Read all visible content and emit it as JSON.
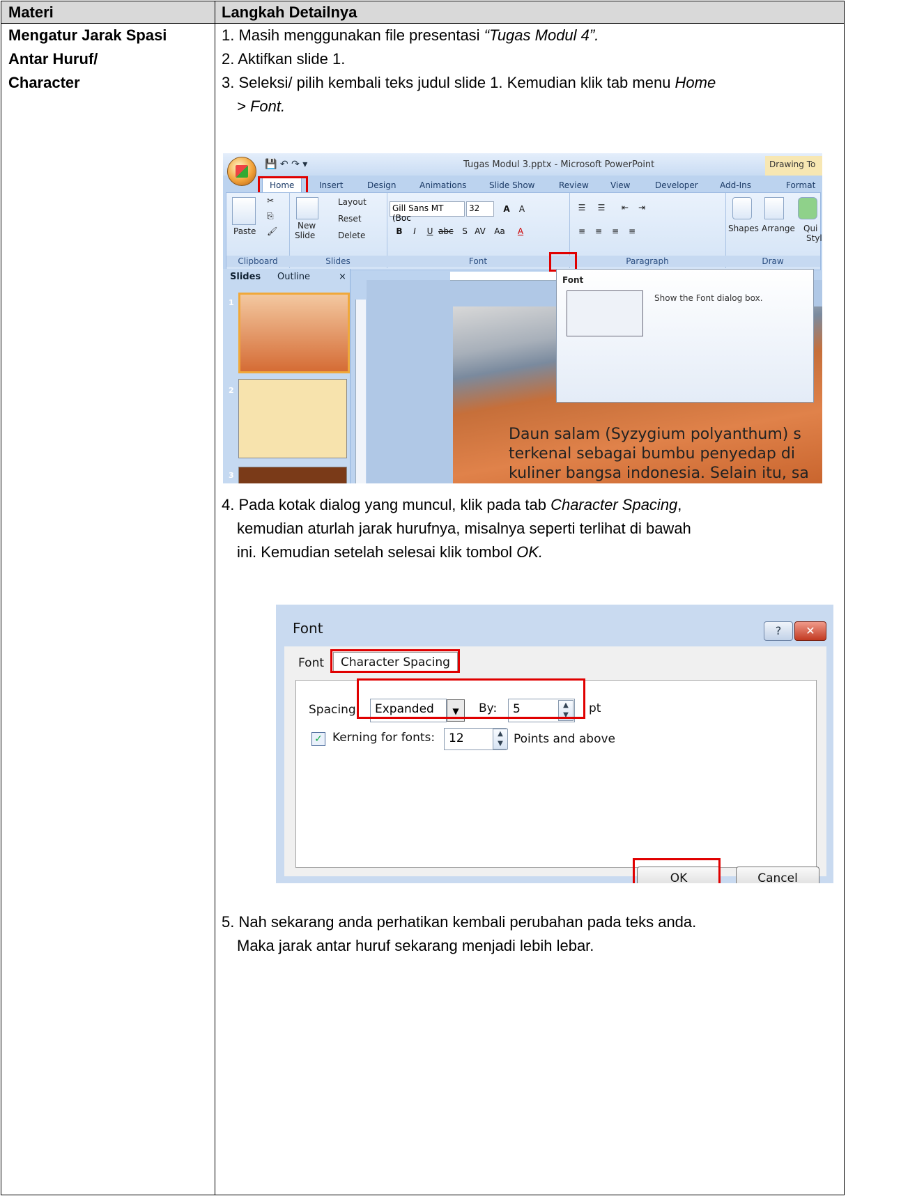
{
  "table": {
    "header": {
      "col1": "Materi",
      "col2": "Langkah Detailnya"
    },
    "materi_lines": [
      "Mengatur Jarak Spasi",
      "Antar Huruf/",
      "Character"
    ],
    "step1": {
      "num": "1.",
      "text": " Masih menggunakan file presentasi ",
      "italic": "“Tugas Modul 4”."
    },
    "step2": "2. Aktifkan slide 1.",
    "step3": {
      "text": "3. Seleksi/ pilih kembali teks judul slide 1. Kemudian klik tab menu ",
      "italic1": "Home",
      "line2_italic": "> Font."
    },
    "step4": {
      "l1a": "4. Pada kotak dialog yang muncul, klik pada tab ",
      "l1i": "Character Spacing",
      "l1b": ",",
      "l2": "kemudian aturlah jarak hurufnya, misalnya seperti terlihat di bawah",
      "l3a": "ini. Kemudian setelah selesai klik tombol ",
      "l3i": "OK."
    },
    "step5": {
      "l1": "5. Nah sekarang anda perhatikan kembali perubahan pada teks anda.",
      "l2": "Maka jarak antar huruf sekarang menjadi lebih lebar."
    }
  },
  "ppt": {
    "window_title": "Tugas Modul 3.pptx - Microsoft PowerPoint",
    "context_tab": "Drawing To",
    "tabs": [
      "Home",
      "Insert",
      "Design",
      "Animations",
      "Slide Show",
      "Review",
      "View",
      "Developer",
      "Add-Ins",
      "Format"
    ],
    "groups": {
      "clipboard": "Clipboard",
      "slides": "Slides",
      "font": "Font",
      "paragraph": "Paragraph",
      "drawing": "Draw"
    },
    "clipboard": {
      "paste": "Paste"
    },
    "slides_group": {
      "new": "New",
      "slide": "Slide",
      "layout": "Layout",
      "reset": "Reset",
      "delete": "Delete"
    },
    "font_name": "Gill Sans MT (Boc",
    "font_size": "32",
    "drawing_labels": {
      "shapes": "Shapes",
      "arrange": "Arrange",
      "quick": "Qui",
      "style": "Styl"
    },
    "pane_tabs": {
      "slides": "Slides",
      "outline": "Outline"
    },
    "thumbs": [
      "1",
      "2",
      "3"
    ],
    "tooltip": {
      "title": "Font",
      "desc": "Show the Font dialog box."
    },
    "slide_text": [
      "Daun salam (Syzygium polyanthum) s",
      "terkenal sebagai bumbu penyedap di",
      "kuliner bangsa indonesia. Selain itu, sa"
    ]
  },
  "dialog": {
    "title": "Font",
    "help": "?",
    "close": "✕",
    "tab_font": "Font",
    "tab_spacing": "Character Spacing",
    "spacing_label": "Spacing:",
    "spacing_value": "Expanded",
    "by_label": "By:",
    "by_value": "5",
    "pt_label": "pt",
    "kerning_label": "Kerning for fonts:",
    "kerning_value": "12",
    "points_label": "Points and above",
    "ok": "OK",
    "cancel": "Cancel"
  },
  "colors": {
    "header_bg": "#d9d9d9",
    "highlight": "#e00000"
  }
}
